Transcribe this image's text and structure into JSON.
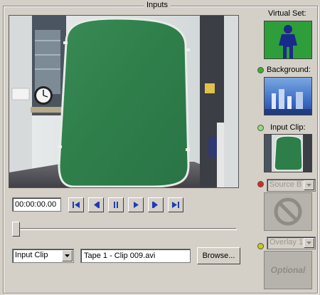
{
  "panel": {
    "title": "Inputs"
  },
  "transport": {
    "timecode": "00:00:00.00",
    "buttons": [
      "skip-to-start",
      "step-back",
      "pause",
      "play",
      "step-forward",
      "skip-to-end"
    ],
    "scrub_position": 0.0
  },
  "source": {
    "type_selected": "Input Clip",
    "clip_name": "Tape 1 - Clip 009.avi",
    "browse_label": "Browse..."
  },
  "right": {
    "virtual_set_label": "Virtual Set:",
    "background_label": "Background:",
    "input_clip_label": "Input Clip:",
    "source_b_selected": "Source B",
    "overlay_selected": "Overlay 1",
    "optional_label": "Optional"
  },
  "colors": {
    "led_background": "#3fae2a",
    "led_input_clip": "#8be07c",
    "led_source_b": "#d62a1e",
    "led_overlay": "#c8c81e",
    "virtual_set_bg": "#2e9e3a",
    "figure": "#1a2a8a"
  }
}
